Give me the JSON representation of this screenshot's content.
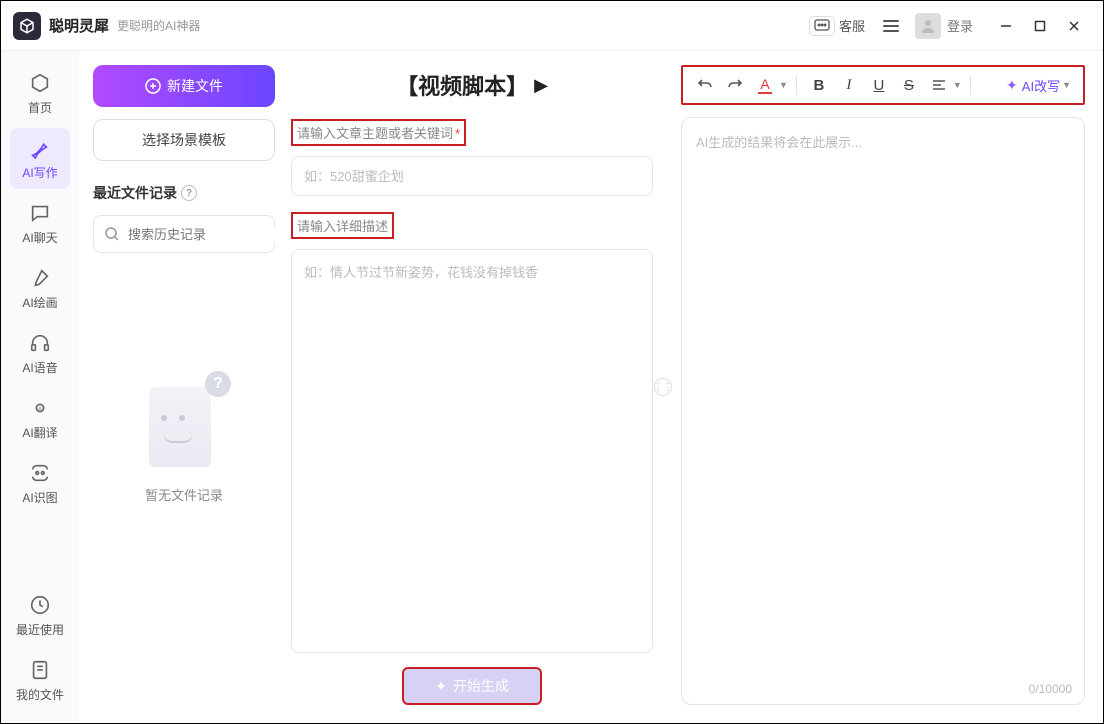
{
  "titlebar": {
    "app_name": "聪明灵犀",
    "tagline": "更聪明的AI神器",
    "support_label": "客服",
    "login_label": "登录"
  },
  "sidebar": {
    "items": [
      {
        "label": "首页"
      },
      {
        "label": "AI写作"
      },
      {
        "label": "AI聊天"
      },
      {
        "label": "AI绘画"
      },
      {
        "label": "AI语音"
      },
      {
        "label": "AI翻译"
      },
      {
        "label": "AI识图"
      }
    ],
    "bottom": [
      {
        "label": "最近使用"
      },
      {
        "label": "我的文件"
      }
    ]
  },
  "leftPanel": {
    "new_file_label": "新建文件",
    "template_label": "选择场景模板",
    "recent_label": "最近文件记录",
    "search_placeholder": "搜索历史记录",
    "empty_text": "暂无文件记录"
  },
  "midPanel": {
    "heading": "【视频脚本】",
    "topic_label": "请输入文章主题或者关键词",
    "topic_placeholder": "如：520甜蜜企划",
    "desc_label": "请输入详细描述",
    "desc_placeholder": "如：情人节过节新姿势，花钱没有掉钱香",
    "generate_label": "开始生成"
  },
  "rightPanel": {
    "ai_rewrite_label": "AI改写",
    "output_placeholder": "AI生成的结果将会在此展示...",
    "counter": "0/10000",
    "toolbar": {
      "font_a": "A",
      "bold": "B",
      "italic": "I",
      "underline": "U",
      "strike": "S"
    }
  }
}
